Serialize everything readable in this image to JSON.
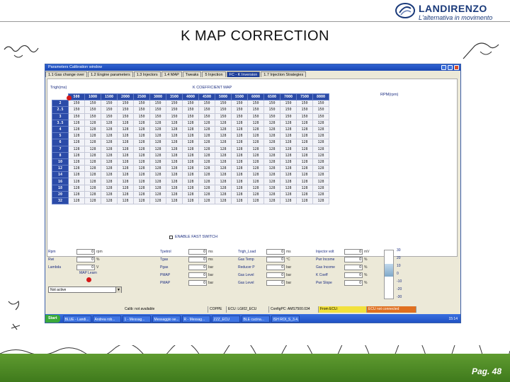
{
  "brand": {
    "name": "LANDIRENZO",
    "tagline": "L'alternativa in movimento",
    "accent": "#1a3a7a"
  },
  "slide": {
    "title": "K MAP CORRECTION",
    "page": "Pag. 48"
  },
  "window": {
    "title": "Parameters Calibration window",
    "tabs": [
      {
        "label": "1.1 Gas change over",
        "active": false
      },
      {
        "label": "1.2 Engine parameters",
        "active": false
      },
      {
        "label": "1.3 Injectors",
        "active": false
      },
      {
        "label": "1.4 MAP",
        "active": false
      },
      {
        "label": "Tweaks",
        "active": false
      },
      {
        "label": "5 Injection",
        "active": false
      },
      {
        "label": "FC - K Inversion",
        "active": true
      },
      {
        "label": "1.7 Injection Strategies",
        "active": false
      }
    ],
    "labels": {
      "rpm_axis": "Trigh(ms)",
      "map_title": "K COEFFICIENT MAP",
      "rpm_unit": "RPM(rpm)",
      "enable_fast": "ENABLE FAST SWITCH"
    },
    "map": {
      "columns": [
        "500",
        "1000",
        "1500",
        "2000",
        "2500",
        "3000",
        "3500",
        "4000",
        "4500",
        "5000",
        "5500",
        "6000",
        "6500",
        "7000",
        "7500",
        "8000"
      ],
      "rows": [
        {
          "h": "2",
          "v": [
            "150",
            "150",
            "150",
            "150",
            "150",
            "150",
            "150",
            "150",
            "150",
            "150",
            "150",
            "150",
            "150",
            "150",
            "150",
            "150"
          ]
        },
        {
          "h": "2.5",
          "v": [
            "150",
            "150",
            "150",
            "150",
            "150",
            "150",
            "150",
            "150",
            "150",
            "150",
            "150",
            "150",
            "150",
            "150",
            "150",
            "150"
          ]
        },
        {
          "h": "3",
          "v": [
            "150",
            "150",
            "150",
            "150",
            "150",
            "150",
            "150",
            "150",
            "150",
            "150",
            "150",
            "150",
            "150",
            "150",
            "150",
            "150"
          ]
        },
        {
          "h": "3.5",
          "v": [
            "128",
            "128",
            "128",
            "128",
            "128",
            "128",
            "128",
            "128",
            "128",
            "128",
            "128",
            "128",
            "128",
            "128",
            "128",
            "128"
          ]
        },
        {
          "h": "4",
          "v": [
            "128",
            "128",
            "128",
            "128",
            "128",
            "128",
            "128",
            "128",
            "128",
            "128",
            "128",
            "128",
            "128",
            "128",
            "128",
            "128"
          ]
        },
        {
          "h": "5",
          "v": [
            "128",
            "128",
            "128",
            "128",
            "128",
            "128",
            "128",
            "128",
            "128",
            "128",
            "128",
            "128",
            "128",
            "128",
            "128",
            "128"
          ]
        },
        {
          "h": "6",
          "v": [
            "128",
            "128",
            "128",
            "128",
            "128",
            "128",
            "128",
            "128",
            "128",
            "128",
            "128",
            "128",
            "128",
            "128",
            "128",
            "128"
          ]
        },
        {
          "h": "7",
          "v": [
            "128",
            "128",
            "128",
            "128",
            "128",
            "128",
            "128",
            "128",
            "128",
            "128",
            "128",
            "128",
            "128",
            "128",
            "128",
            "128"
          ]
        },
        {
          "h": "8",
          "v": [
            "128",
            "128",
            "128",
            "128",
            "128",
            "128",
            "128",
            "128",
            "128",
            "128",
            "128",
            "128",
            "128",
            "128",
            "128",
            "128"
          ]
        },
        {
          "h": "10",
          "v": [
            "128",
            "128",
            "128",
            "128",
            "128",
            "128",
            "128",
            "128",
            "128",
            "128",
            "128",
            "128",
            "128",
            "128",
            "128",
            "128"
          ]
        },
        {
          "h": "12",
          "v": [
            "128",
            "128",
            "128",
            "128",
            "128",
            "128",
            "128",
            "128",
            "128",
            "128",
            "128",
            "128",
            "128",
            "128",
            "128",
            "128"
          ]
        },
        {
          "h": "14",
          "v": [
            "128",
            "128",
            "128",
            "128",
            "128",
            "128",
            "128",
            "128",
            "128",
            "128",
            "128",
            "128",
            "128",
            "128",
            "128",
            "128"
          ]
        },
        {
          "h": "16",
          "v": [
            "128",
            "128",
            "128",
            "128",
            "128",
            "128",
            "128",
            "128",
            "128",
            "128",
            "128",
            "128",
            "128",
            "128",
            "128",
            "128"
          ]
        },
        {
          "h": "18",
          "v": [
            "128",
            "128",
            "128",
            "128",
            "128",
            "128",
            "128",
            "128",
            "128",
            "128",
            "128",
            "128",
            "128",
            "128",
            "128",
            "128"
          ]
        },
        {
          "h": "20",
          "v": [
            "128",
            "128",
            "128",
            "128",
            "128",
            "128",
            "128",
            "128",
            "128",
            "128",
            "128",
            "128",
            "128",
            "128",
            "128",
            "128"
          ]
        },
        {
          "h": "32",
          "v": [
            "128",
            "128",
            "128",
            "128",
            "128",
            "128",
            "128",
            "128",
            "128",
            "128",
            "128",
            "128",
            "128",
            "128",
            "128",
            "128"
          ]
        }
      ]
    },
    "params": {
      "col1": [
        {
          "label": "Rpm",
          "value": "0",
          "unit": "rpm"
        },
        {
          "label": "Rwi",
          "value": "0",
          "unit": "%"
        },
        {
          "label": "Lambda",
          "value": "0",
          "unit": "V"
        }
      ],
      "col2": [
        {
          "label": "Tpetrol",
          "value": "0",
          "unit": "ms"
        },
        {
          "label": "Tgas",
          "value": "0",
          "unit": "ms"
        },
        {
          "label": "Pgas",
          "value": "0",
          "unit": "bar"
        },
        {
          "label": "PMAP",
          "value": "0",
          "unit": "bar"
        },
        {
          "label": "PMAP",
          "value": "0",
          "unit": "bar"
        }
      ],
      "col3": [
        {
          "label": "Trigh_Load",
          "value": "0",
          "unit": "ms"
        },
        {
          "label": "Gas Temp",
          "value": "0",
          "unit": "°C"
        },
        {
          "label": "Reducer P",
          "value": "0",
          "unit": "bar"
        },
        {
          "label": "Gas Level",
          "value": "0",
          "unit": "bar"
        },
        {
          "label": "Gas Level",
          "value": "0",
          "unit": "bar"
        }
      ],
      "col4": [
        {
          "label": "Injector volt",
          "value": "0",
          "unit": "mV"
        },
        {
          "label": "Pwr Income",
          "value": "0",
          "unit": "%"
        },
        {
          "label": "Gas Income",
          "value": "0",
          "unit": "%"
        },
        {
          "label": "K Coeff",
          "value": "0",
          "unit": "%"
        },
        {
          "label": "Pwr Slope",
          "value": "0",
          "unit": "%"
        }
      ],
      "map_learn_label": "MAP Learn",
      "mode_value": "Not active"
    },
    "gauge_scale": [
      "30",
      "20",
      "10",
      "0",
      "-10",
      "-20",
      "-30"
    ],
    "status": [
      {
        "text": "Calib: not available",
        "kind": "normal"
      },
      {
        "text": "COPPE",
        "kind": "normal"
      },
      {
        "text": "ECU: LGI02_ECU",
        "kind": "normal"
      },
      {
        "text": "ConfigPC: AMS7500.034",
        "kind": "normal"
      },
      {
        "text": "From ECU:",
        "kind": "warn"
      },
      {
        "text": "ECU not connected",
        "kind": "err"
      }
    ],
    "taskbar": {
      "start": "Start",
      "tasks": [
        "BLUE - Landi...",
        "Andrea rob...",
        "1 - Messag...",
        "Messaggio se...",
        "R - Messag...",
        "ZZZ_ECU",
        "BLE cucina...",
        "ISH ROI_S_3.4.."
      ],
      "clock": "15:14"
    }
  }
}
